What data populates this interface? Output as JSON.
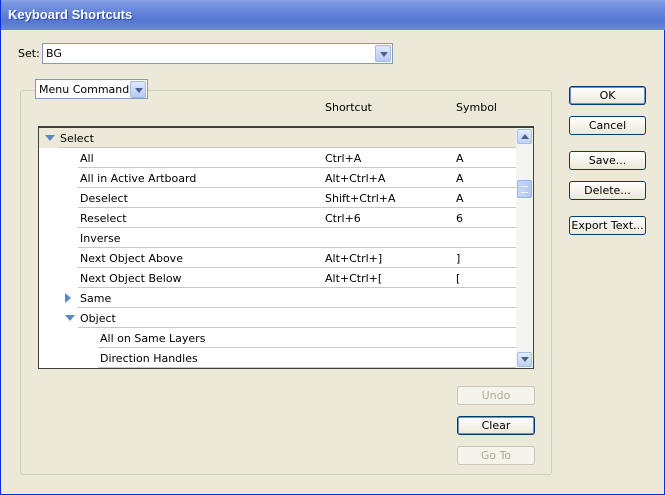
{
  "window": {
    "title": "Keyboard Shortcuts"
  },
  "set": {
    "label": "Set:",
    "value": "BG"
  },
  "category": {
    "value": "Menu Commands"
  },
  "columns": {
    "shortcut": "Shortcut",
    "symbol": "Symbol"
  },
  "rows": [
    {
      "type": "group",
      "expanded": true,
      "indent": 0,
      "name": "Select",
      "shortcut": "",
      "symbol": ""
    },
    {
      "type": "item",
      "indent": 1,
      "name": "All",
      "shortcut": "Ctrl+A",
      "symbol": "A"
    },
    {
      "type": "item",
      "indent": 1,
      "name": "All in Active Artboard",
      "shortcut": "Alt+Ctrl+A",
      "symbol": "A"
    },
    {
      "type": "item",
      "indent": 1,
      "name": "Deselect",
      "shortcut": "Shift+Ctrl+A",
      "symbol": "A"
    },
    {
      "type": "item",
      "indent": 1,
      "name": "Reselect",
      "shortcut": "Ctrl+6",
      "symbol": "6"
    },
    {
      "type": "item",
      "indent": 1,
      "name": "Inverse",
      "shortcut": "",
      "symbol": ""
    },
    {
      "type": "item",
      "indent": 1,
      "name": "Next Object Above",
      "shortcut": "Alt+Ctrl+]",
      "symbol": "]"
    },
    {
      "type": "item",
      "indent": 1,
      "name": "Next Object Below",
      "shortcut": "Alt+Ctrl+[",
      "symbol": "["
    },
    {
      "type": "group",
      "expanded": false,
      "indent": 1,
      "name": "Same",
      "shortcut": "",
      "symbol": ""
    },
    {
      "type": "group",
      "expanded": true,
      "indent": 1,
      "name": "Object",
      "shortcut": "",
      "symbol": ""
    },
    {
      "type": "item",
      "indent": 2,
      "name": "All on Same Layers",
      "shortcut": "",
      "symbol": ""
    },
    {
      "type": "item",
      "indent": 2,
      "name": "Direction Handles",
      "shortcut": "",
      "symbol": ""
    }
  ],
  "buttons": {
    "ok": "OK",
    "cancel": "Cancel",
    "save": "Save...",
    "delete": "Delete...",
    "export": "Export Text...",
    "undo": "Undo",
    "clear": "Clear",
    "goto": "Go To"
  }
}
